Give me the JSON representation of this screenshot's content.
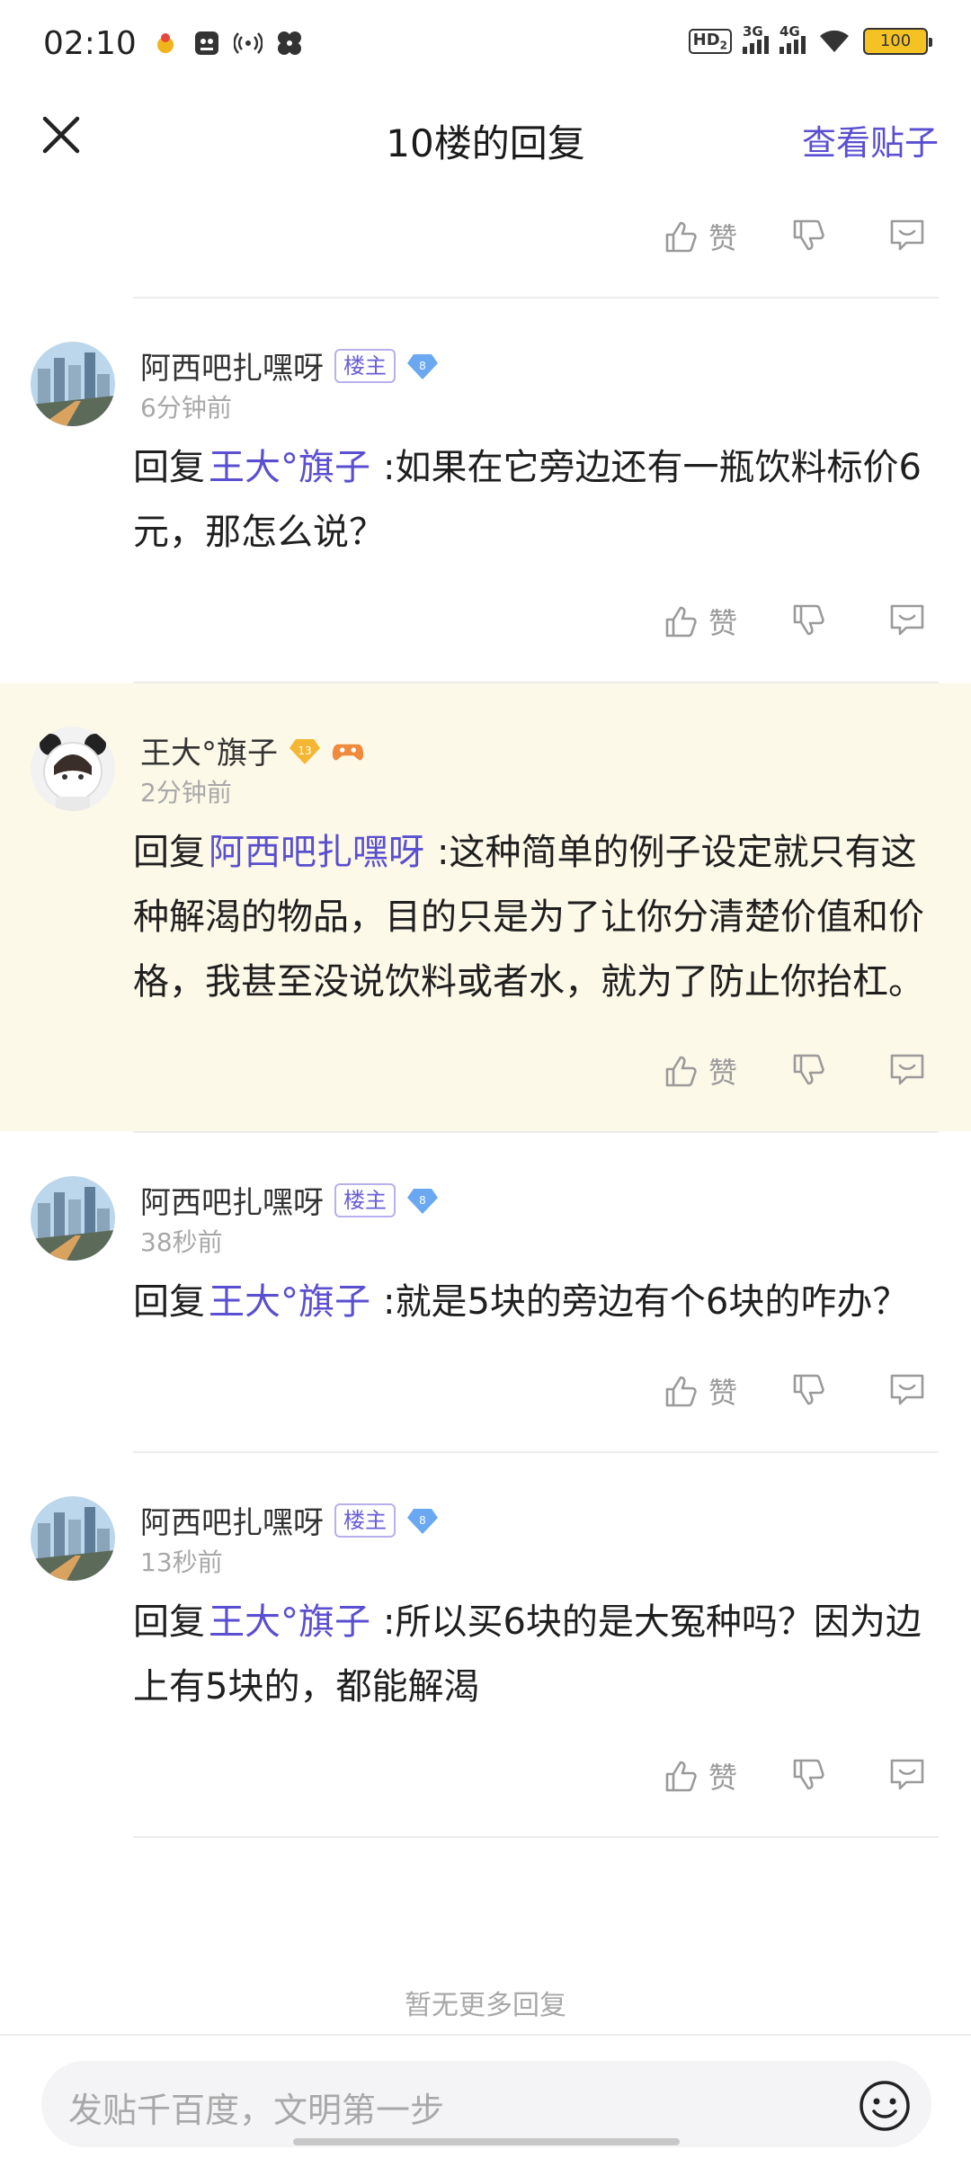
{
  "status_bar": {
    "time": "02:10",
    "hd": "HD",
    "hd_sub": "2",
    "net1": "3G",
    "net2": "4G",
    "battery": "100"
  },
  "nav": {
    "title": "10楼的回复",
    "view_post": "查看贴子"
  },
  "actions": {
    "like_label": "赞"
  },
  "replies": [
    {
      "user": "阿西吧扎嘿呀",
      "owner_tag": "楼主",
      "level": "8",
      "time": "6分钟前",
      "prefix": "回复",
      "mention": "王大°旗子",
      "text": ":如果在它旁边还有一瓶饮料标价6元，那怎么说？",
      "highlight": false
    },
    {
      "user": "王大°旗子",
      "level": "13",
      "time": "2分钟前",
      "prefix": "回复",
      "mention": "阿西吧扎嘿呀",
      "text": ":这种简单的例子设定就只有这种解渴的物品，目的只是为了让你分清楚价值和价格，我甚至没说饮料或者水，就为了防止你抬杠。",
      "highlight": true
    },
    {
      "user": "阿西吧扎嘿呀",
      "owner_tag": "楼主",
      "level": "8",
      "time": "38秒前",
      "prefix": "回复",
      "mention": "王大°旗子",
      "text": ":就是5块的旁边有个6块的咋办？",
      "highlight": false
    },
    {
      "user": "阿西吧扎嘿呀",
      "owner_tag": "楼主",
      "level": "8",
      "time": "13秒前",
      "prefix": "回复",
      "mention": "王大°旗子",
      "text": ":所以买6块的是大冤种吗？因为边上有5块的，都能解渴",
      "highlight": false
    }
  ],
  "footer": {
    "no_more": "暂无更多回复",
    "input_placeholder": "发贴千百度，文明第一步"
  },
  "colors": {
    "accent": "#5a4fd0",
    "highlight_bg": "#fdf9e8",
    "muted": "#a8a8a8"
  }
}
